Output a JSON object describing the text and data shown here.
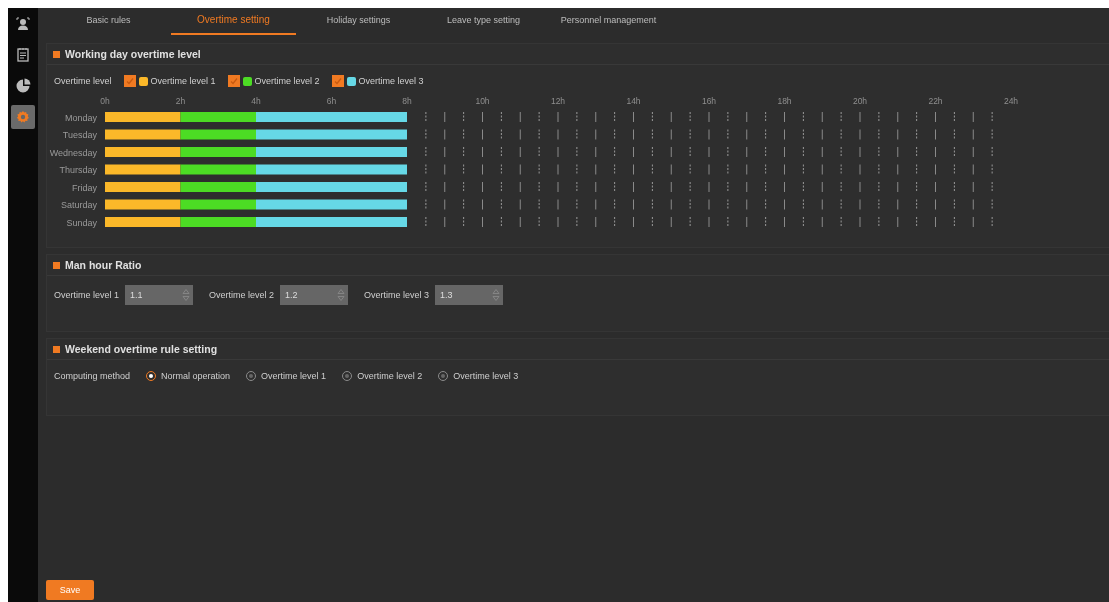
{
  "sidebar": {
    "items": [
      {
        "kind": "person",
        "selected": false
      },
      {
        "kind": "notes",
        "selected": false
      },
      {
        "kind": "chart",
        "selected": false
      },
      {
        "kind": "settings",
        "selected": true
      }
    ]
  },
  "tabs": [
    {
      "label": "Basic rules",
      "selected": false
    },
    {
      "label": "Overtime setting",
      "selected": true
    },
    {
      "label": "Holiday settings",
      "selected": false
    },
    {
      "label": "Leave type setting",
      "selected": false
    },
    {
      "label": "Personnel management",
      "selected": false
    }
  ],
  "working_day": {
    "title": "Working day overtime level",
    "legend_label": "Overtime level",
    "legend": [
      {
        "checked": true
      },
      {
        "checked": true
      },
      {
        "checked": true
      }
    ],
    "chart_data": {
      "type": "bar",
      "orientation": "horizontal",
      "stacked": true,
      "categories": [
        "Monday",
        "Tuesday",
        "Wednesday",
        "Thursday",
        "Friday",
        "Saturday",
        "Sunday"
      ],
      "series": [
        {
          "name": "Overtime level 1",
          "color": "#fbb829",
          "values": [
            2,
            2,
            2,
            2,
            2,
            2,
            2
          ]
        },
        {
          "name": "Overtime level 2",
          "color": "#4cdc24",
          "values": [
            2,
            2,
            2,
            2,
            2,
            2,
            2
          ]
        },
        {
          "name": "Overtime level 3",
          "color": "#66d8e6",
          "values": [
            4,
            4,
            4,
            4,
            4,
            4,
            4
          ]
        }
      ],
      "xlim": [
        0,
        24
      ],
      "xticks": [
        {
          "value": 0,
          "label": "0h"
        },
        {
          "value": 2,
          "label": "2h"
        },
        {
          "value": 4,
          "label": "4h"
        },
        {
          "value": 6,
          "label": "6h"
        },
        {
          "value": 8,
          "label": "8h"
        },
        {
          "value": 10,
          "label": "10h"
        },
        {
          "value": 12,
          "label": "12h"
        },
        {
          "value": 14,
          "label": "14h"
        },
        {
          "value": 16,
          "label": "16h"
        },
        {
          "value": 18,
          "label": "18h"
        },
        {
          "value": 20,
          "label": "20h"
        },
        {
          "value": 22,
          "label": "22h"
        },
        {
          "value": 24,
          "label": "24h"
        }
      ]
    }
  },
  "man_hour_ratio": {
    "title": "Man hour Ratio",
    "fields": [
      {
        "label": "Overtime level 1",
        "value": "1.1"
      },
      {
        "label": "Overtime level 2",
        "value": "1.2"
      },
      {
        "label": "Overtime level 3",
        "value": "1.3"
      }
    ]
  },
  "weekend": {
    "title": "Weekend overtime rule setting",
    "label": "Computing method",
    "options": [
      {
        "label": "Normal operation",
        "selected": true
      },
      {
        "label": "Overtime level 1",
        "selected": false
      },
      {
        "label": "Overtime level 2",
        "selected": false
      },
      {
        "label": "Overtime level 3",
        "selected": false
      }
    ]
  },
  "save_button": "Save"
}
